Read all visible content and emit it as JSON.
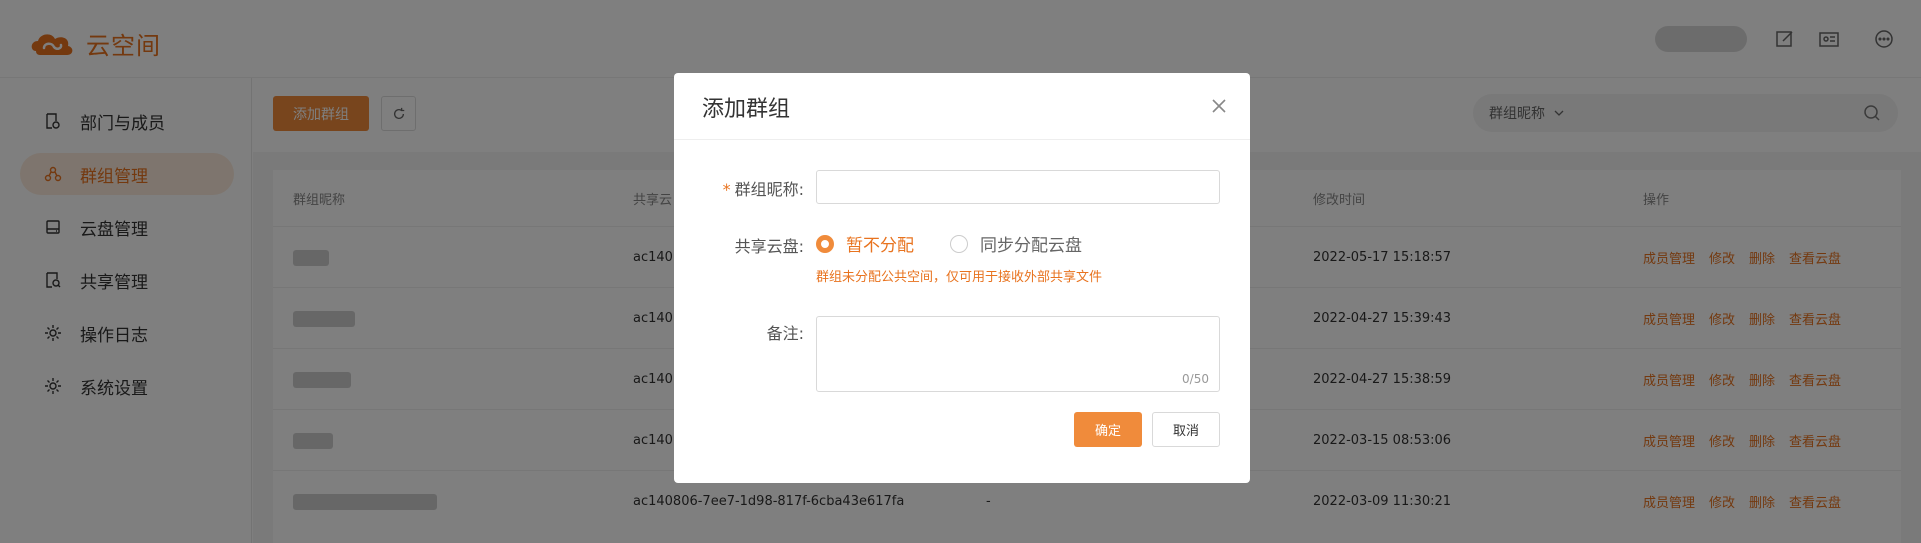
{
  "app": {
    "name": "云空间"
  },
  "header": {
    "icons": [
      "edit-icon",
      "id-card-icon",
      "more-icon"
    ]
  },
  "sidebar": {
    "items": [
      {
        "label": "部门与成员",
        "icon": "department-icon",
        "active": false
      },
      {
        "label": "群组管理",
        "icon": "group-icon",
        "active": true
      },
      {
        "label": "云盘管理",
        "icon": "cloud-disk-icon",
        "active": false
      },
      {
        "label": "共享管理",
        "icon": "share-icon",
        "active": false
      },
      {
        "label": "操作日志",
        "icon": "log-icon",
        "active": false
      },
      {
        "label": "系统设置",
        "icon": "settings-icon",
        "active": false
      }
    ]
  },
  "toolbar": {
    "add_label": "添加群组",
    "search_field": "群组昵称"
  },
  "table": {
    "columns": [
      "群组昵称",
      "共享云",
      "修改时间",
      "操作"
    ],
    "rows": [
      {
        "col2": "ac140",
        "dash": "",
        "modified": "2022-05-17 15:18:57"
      },
      {
        "col2": "ac140",
        "dash": "",
        "modified": "2022-04-27 15:39:43"
      },
      {
        "col2": "ac140",
        "dash": "",
        "modified": "2022-04-27 15:38:59"
      },
      {
        "col2": "ac140",
        "dash": "",
        "modified": "2022-03-15 08:53:06"
      },
      {
        "col2": "ac140806-7ee7-1d98-817f-6cba43e617fa",
        "dash": "-",
        "modified": "2022-03-09 11:30:21"
      }
    ],
    "ops": [
      "成员管理",
      "修改",
      "删除",
      "查看云盘"
    ]
  },
  "modal": {
    "title": "添加群组",
    "name_label": "群组昵称:",
    "required_mark": "*",
    "disk_label": "共享云盘:",
    "radio_options": [
      {
        "label": "暂不分配",
        "checked": true
      },
      {
        "label": "同步分配云盘",
        "checked": false
      }
    ],
    "hint": "群组未分配公共空间，仅可用于接收外部共享文件",
    "remark_label": "备注:",
    "remark_count": "0/50",
    "ok_label": "确定",
    "cancel_label": "取消"
  },
  "colors": {
    "accent": "#f08b3b",
    "accent_text": "#e8731f"
  }
}
